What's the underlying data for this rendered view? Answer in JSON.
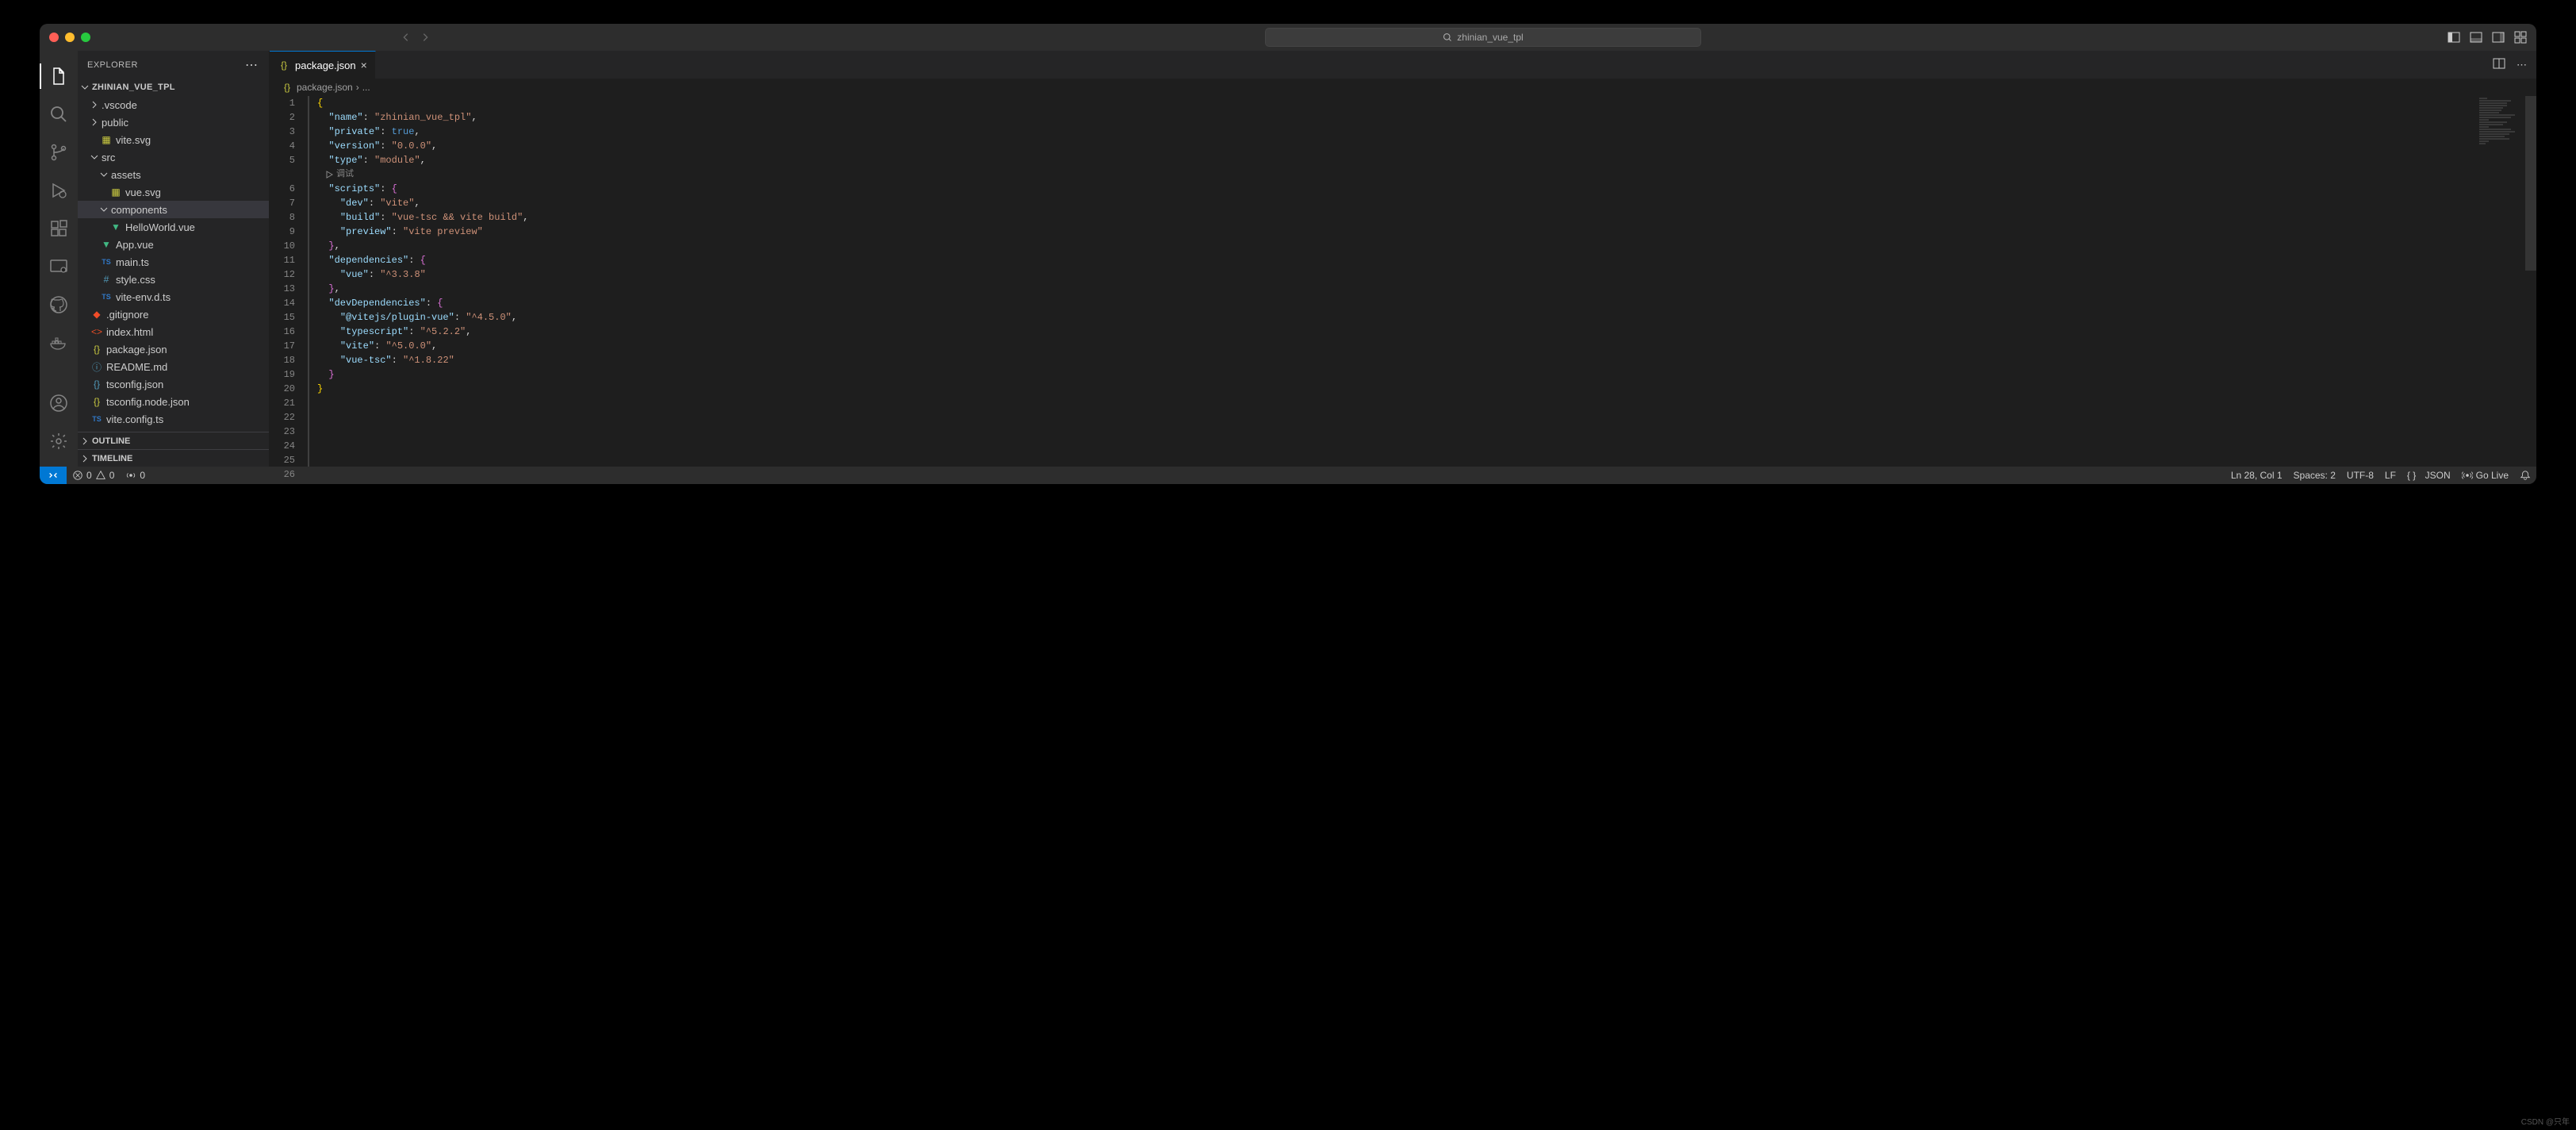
{
  "window": {
    "title": "zhinian_vue_tpl"
  },
  "sidebar": {
    "header": "EXPLORER",
    "project": "ZHINIAN_VUE_TPL",
    "tree": [
      {
        "kind": "folder",
        "open": false,
        "indent": 0,
        "label": ".vscode"
      },
      {
        "kind": "folder",
        "open": false,
        "indent": 0,
        "label": "public"
      },
      {
        "kind": "file",
        "indent": 1,
        "label": "vite.svg",
        "icon": "svg"
      },
      {
        "kind": "folder",
        "open": true,
        "indent": 0,
        "label": "src"
      },
      {
        "kind": "folder",
        "open": true,
        "indent": 1,
        "label": "assets"
      },
      {
        "kind": "file",
        "indent": 2,
        "label": "vue.svg",
        "icon": "svg"
      },
      {
        "kind": "folder",
        "open": true,
        "indent": 1,
        "label": "components",
        "selected": true
      },
      {
        "kind": "file",
        "indent": 2,
        "label": "HelloWorld.vue",
        "icon": "vue"
      },
      {
        "kind": "file",
        "indent": 1,
        "label": "App.vue",
        "icon": "vue"
      },
      {
        "kind": "file",
        "indent": 1,
        "label": "main.ts",
        "icon": "ts"
      },
      {
        "kind": "file",
        "indent": 1,
        "label": "style.css",
        "icon": "css"
      },
      {
        "kind": "file",
        "indent": 1,
        "label": "vite-env.d.ts",
        "icon": "ts"
      },
      {
        "kind": "file",
        "indent": 0,
        "label": ".gitignore",
        "icon": "git"
      },
      {
        "kind": "file",
        "indent": 0,
        "label": "index.html",
        "icon": "html"
      },
      {
        "kind": "file",
        "indent": 0,
        "label": "package.json",
        "icon": "json"
      },
      {
        "kind": "file",
        "indent": 0,
        "label": "README.md",
        "icon": "md"
      },
      {
        "kind": "file",
        "indent": 0,
        "label": "tsconfig.json",
        "icon": "json-blue"
      },
      {
        "kind": "file",
        "indent": 0,
        "label": "tsconfig.node.json",
        "icon": "json"
      },
      {
        "kind": "file",
        "indent": 0,
        "label": "vite.config.ts",
        "icon": "ts"
      }
    ],
    "sections": {
      "outline": "OUTLINE",
      "timeline": "TIMELINE"
    }
  },
  "tabs": {
    "active": {
      "label": "package.json"
    }
  },
  "breadcrumb": {
    "file": "package.json",
    "rest": "..."
  },
  "editor": {
    "debug_hint": "调试",
    "code_lines": [
      {
        "n": 1,
        "tokens": [
          {
            "t": "{",
            "c": "brace"
          }
        ]
      },
      {
        "n": 2,
        "tokens": [
          {
            "t": "  ",
            "c": ""
          },
          {
            "t": "\"name\"",
            "c": "key"
          },
          {
            "t": ": ",
            "c": "punc"
          },
          {
            "t": "\"zhinian_vue_tpl\"",
            "c": "str"
          },
          {
            "t": ",",
            "c": "punc"
          }
        ]
      },
      {
        "n": 3,
        "tokens": [
          {
            "t": "  ",
            "c": ""
          },
          {
            "t": "\"private\"",
            "c": "key"
          },
          {
            "t": ": ",
            "c": "punc"
          },
          {
            "t": "true",
            "c": "bool"
          },
          {
            "t": ",",
            "c": "punc"
          }
        ]
      },
      {
        "n": 4,
        "tokens": [
          {
            "t": "  ",
            "c": ""
          },
          {
            "t": "\"version\"",
            "c": "key"
          },
          {
            "t": ": ",
            "c": "punc"
          },
          {
            "t": "\"0.0.0\"",
            "c": "str"
          },
          {
            "t": ",",
            "c": "punc"
          }
        ]
      },
      {
        "n": 5,
        "tokens": [
          {
            "t": "  ",
            "c": ""
          },
          {
            "t": "\"type\"",
            "c": "key"
          },
          {
            "t": ": ",
            "c": "punc"
          },
          {
            "t": "\"module\"",
            "c": "str"
          },
          {
            "t": ",",
            "c": "punc"
          }
        ]
      },
      {
        "n": 6,
        "tokens": [
          {
            "t": "  ",
            "c": ""
          },
          {
            "t": "\"scripts\"",
            "c": "key"
          },
          {
            "t": ": ",
            "c": "punc"
          },
          {
            "t": "{",
            "c": "brace2"
          }
        ]
      },
      {
        "n": 7,
        "tokens": [
          {
            "t": "    ",
            "c": ""
          },
          {
            "t": "\"dev\"",
            "c": "key"
          },
          {
            "t": ": ",
            "c": "punc"
          },
          {
            "t": "\"vite\"",
            "c": "str"
          },
          {
            "t": ",",
            "c": "punc"
          }
        ]
      },
      {
        "n": 8,
        "tokens": [
          {
            "t": "    ",
            "c": ""
          },
          {
            "t": "\"build\"",
            "c": "key"
          },
          {
            "t": ": ",
            "c": "punc"
          },
          {
            "t": "\"vue-tsc && vite build\"",
            "c": "str"
          },
          {
            "t": ",",
            "c": "punc"
          }
        ]
      },
      {
        "n": 9,
        "tokens": [
          {
            "t": "    ",
            "c": ""
          },
          {
            "t": "\"preview\"",
            "c": "key"
          },
          {
            "t": ": ",
            "c": "punc"
          },
          {
            "t": "\"vite preview\"",
            "c": "str"
          }
        ]
      },
      {
        "n": 10,
        "tokens": [
          {
            "t": "  ",
            "c": ""
          },
          {
            "t": "}",
            "c": "brace2"
          },
          {
            "t": ",",
            "c": "punc"
          }
        ]
      },
      {
        "n": 11,
        "tokens": [
          {
            "t": "  ",
            "c": ""
          },
          {
            "t": "\"dependencies\"",
            "c": "key"
          },
          {
            "t": ": ",
            "c": "punc"
          },
          {
            "t": "{",
            "c": "brace2"
          }
        ]
      },
      {
        "n": 12,
        "tokens": [
          {
            "t": "    ",
            "c": ""
          },
          {
            "t": "\"vue\"",
            "c": "key"
          },
          {
            "t": ": ",
            "c": "punc"
          },
          {
            "t": "\"^3.3.8\"",
            "c": "str"
          }
        ]
      },
      {
        "n": 13,
        "tokens": [
          {
            "t": "  ",
            "c": ""
          },
          {
            "t": "}",
            "c": "brace2"
          },
          {
            "t": ",",
            "c": "punc"
          }
        ]
      },
      {
        "n": 14,
        "tokens": [
          {
            "t": "  ",
            "c": ""
          },
          {
            "t": "\"devDependencies\"",
            "c": "key"
          },
          {
            "t": ": ",
            "c": "punc"
          },
          {
            "t": "{",
            "c": "brace2"
          }
        ]
      },
      {
        "n": 15,
        "tokens": [
          {
            "t": "    ",
            "c": ""
          },
          {
            "t": "\"@vitejs/plugin-vue\"",
            "c": "key"
          },
          {
            "t": ": ",
            "c": "punc"
          },
          {
            "t": "\"^4.5.0\"",
            "c": "str"
          },
          {
            "t": ",",
            "c": "punc"
          }
        ]
      },
      {
        "n": 16,
        "tokens": [
          {
            "t": "    ",
            "c": ""
          },
          {
            "t": "\"typescript\"",
            "c": "key"
          },
          {
            "t": ": ",
            "c": "punc"
          },
          {
            "t": "\"^5.2.2\"",
            "c": "str"
          },
          {
            "t": ",",
            "c": "punc"
          }
        ]
      },
      {
        "n": 17,
        "tokens": [
          {
            "t": "    ",
            "c": ""
          },
          {
            "t": "\"vite\"",
            "c": "key"
          },
          {
            "t": ": ",
            "c": "punc"
          },
          {
            "t": "\"^5.0.0\"",
            "c": "str"
          },
          {
            "t": ",",
            "c": "punc"
          }
        ]
      },
      {
        "n": 18,
        "tokens": [
          {
            "t": "    ",
            "c": ""
          },
          {
            "t": "\"vue-tsc\"",
            "c": "key"
          },
          {
            "t": ": ",
            "c": "punc"
          },
          {
            "t": "\"^1.8.22\"",
            "c": "str"
          }
        ]
      },
      {
        "n": 19,
        "tokens": [
          {
            "t": "  ",
            "c": ""
          },
          {
            "t": "}",
            "c": "brace2"
          }
        ]
      },
      {
        "n": 20,
        "tokens": [
          {
            "t": "}",
            "c": "brace"
          }
        ]
      },
      {
        "n": 21,
        "tokens": []
      },
      {
        "n": 22,
        "tokens": []
      },
      {
        "n": 23,
        "tokens": []
      },
      {
        "n": 24,
        "tokens": []
      },
      {
        "n": 25,
        "tokens": []
      },
      {
        "n": 26,
        "tokens": []
      }
    ]
  },
  "status": {
    "errors": "0",
    "warnings": "0",
    "ports": "0",
    "ln_col": "Ln 28, Col 1",
    "spaces": "Spaces: 2",
    "encoding": "UTF-8",
    "eol": "LF",
    "language": "JSON",
    "golive": "Go Live"
  },
  "watermark": "CSDN @只年"
}
